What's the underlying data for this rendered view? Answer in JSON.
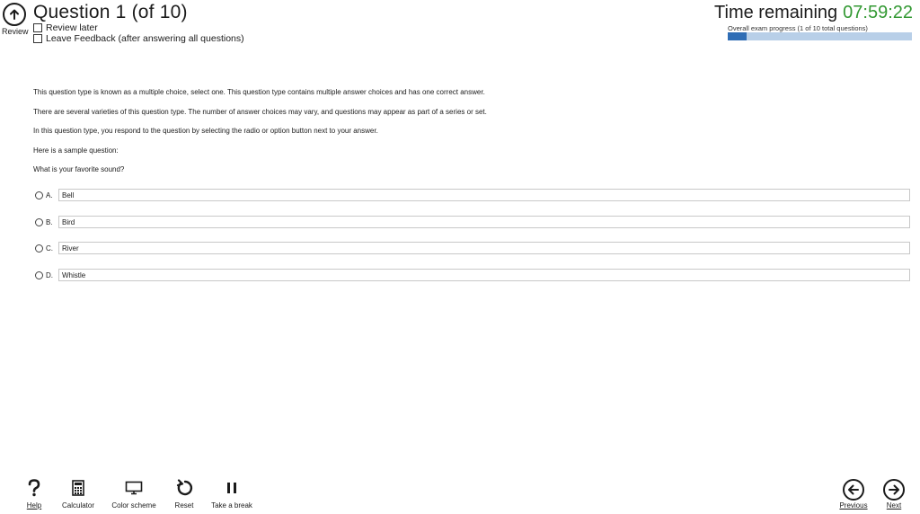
{
  "header": {
    "review_label": "Review",
    "question_title": "Question  1 (of 10)",
    "review_later_label": "Review later",
    "leave_feedback_label": "Leave Feedback (after answering all questions)",
    "time_label": "Time remaining",
    "time_value": "07:59:22",
    "progress_label": "Overall exam progress (1 of 10 total questions)",
    "progress_fraction": 0.1
  },
  "question": {
    "paragraphs": [
      "This question type is known as a multiple choice, select one. This question type contains multiple answer choices and has one correct answer.",
      "There are several varieties of this question type. The number of answer choices may vary, and questions may appear as part of a series or set.",
      "In this question type, you respond to the question by selecting the radio or option button next to your answer.",
      "Here is a sample question:",
      "What is your favorite sound?"
    ],
    "options": [
      {
        "letter": "A.",
        "text": "Bell"
      },
      {
        "letter": "B.",
        "text": "Bird"
      },
      {
        "letter": "C.",
        "text": "River"
      },
      {
        "letter": "D.",
        "text": "Whistle"
      }
    ]
  },
  "footer": {
    "help_label": "Help",
    "calculator_label": "Calculator",
    "color_scheme_label": "Color scheme",
    "reset_label": "Reset",
    "break_label": "Take a break",
    "previous_label": "Previous",
    "next_label": "Next"
  },
  "colors": {
    "timer": "#339933",
    "progress_fill": "#2f6db5",
    "progress_track": "#b8cfe8"
  },
  "icons": [
    "review-icon",
    "help-icon",
    "calculator-icon",
    "monitor-icon",
    "reset-icon",
    "pause-icon",
    "previous-arrow-icon",
    "next-arrow-icon"
  ]
}
